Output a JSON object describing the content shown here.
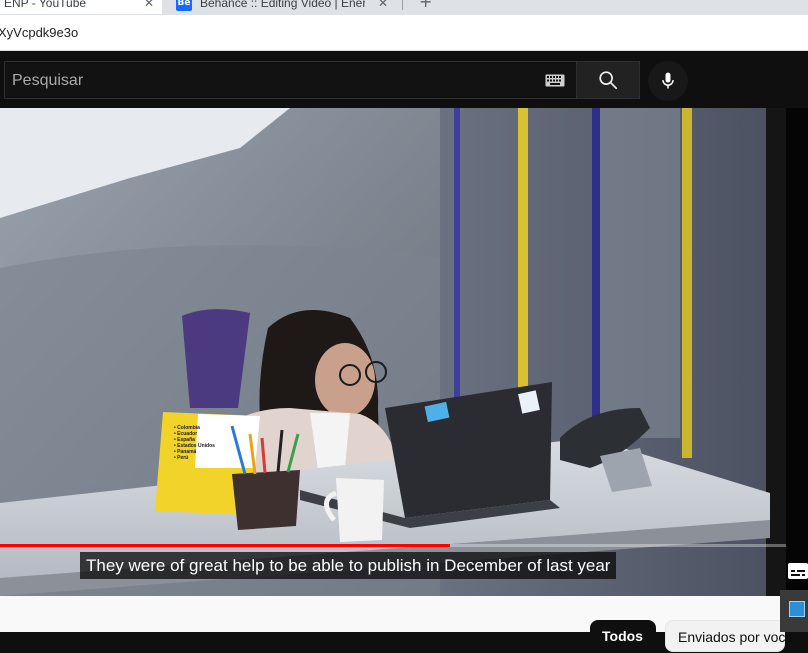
{
  "browser": {
    "tabs": [
      {
        "title": "ENP - YouTube",
        "active": true
      },
      {
        "title": "Behance :: Editing Video | Energ",
        "active": false,
        "favicon": "Bē"
      }
    ],
    "address": "XyVcpdk9e3o"
  },
  "header": {
    "search_placeholder": "Pesquisar",
    "icons": [
      "keyboard-icon",
      "search-icon",
      "microphone-icon"
    ]
  },
  "video": {
    "caption": "They were of great help to be able to publish in December of last year",
    "progress": 0.573,
    "sticker_lines": [
      "Colombia",
      "Ecuador",
      "España",
      "Estados Unidos",
      "Panamá",
      "Perú"
    ]
  },
  "chips": [
    "Todos",
    "Enviados por você"
  ],
  "colors": {
    "progress": "#ff0000",
    "header_bg": "#0f0f0f",
    "notebook_yellow": "#f1d32a"
  }
}
